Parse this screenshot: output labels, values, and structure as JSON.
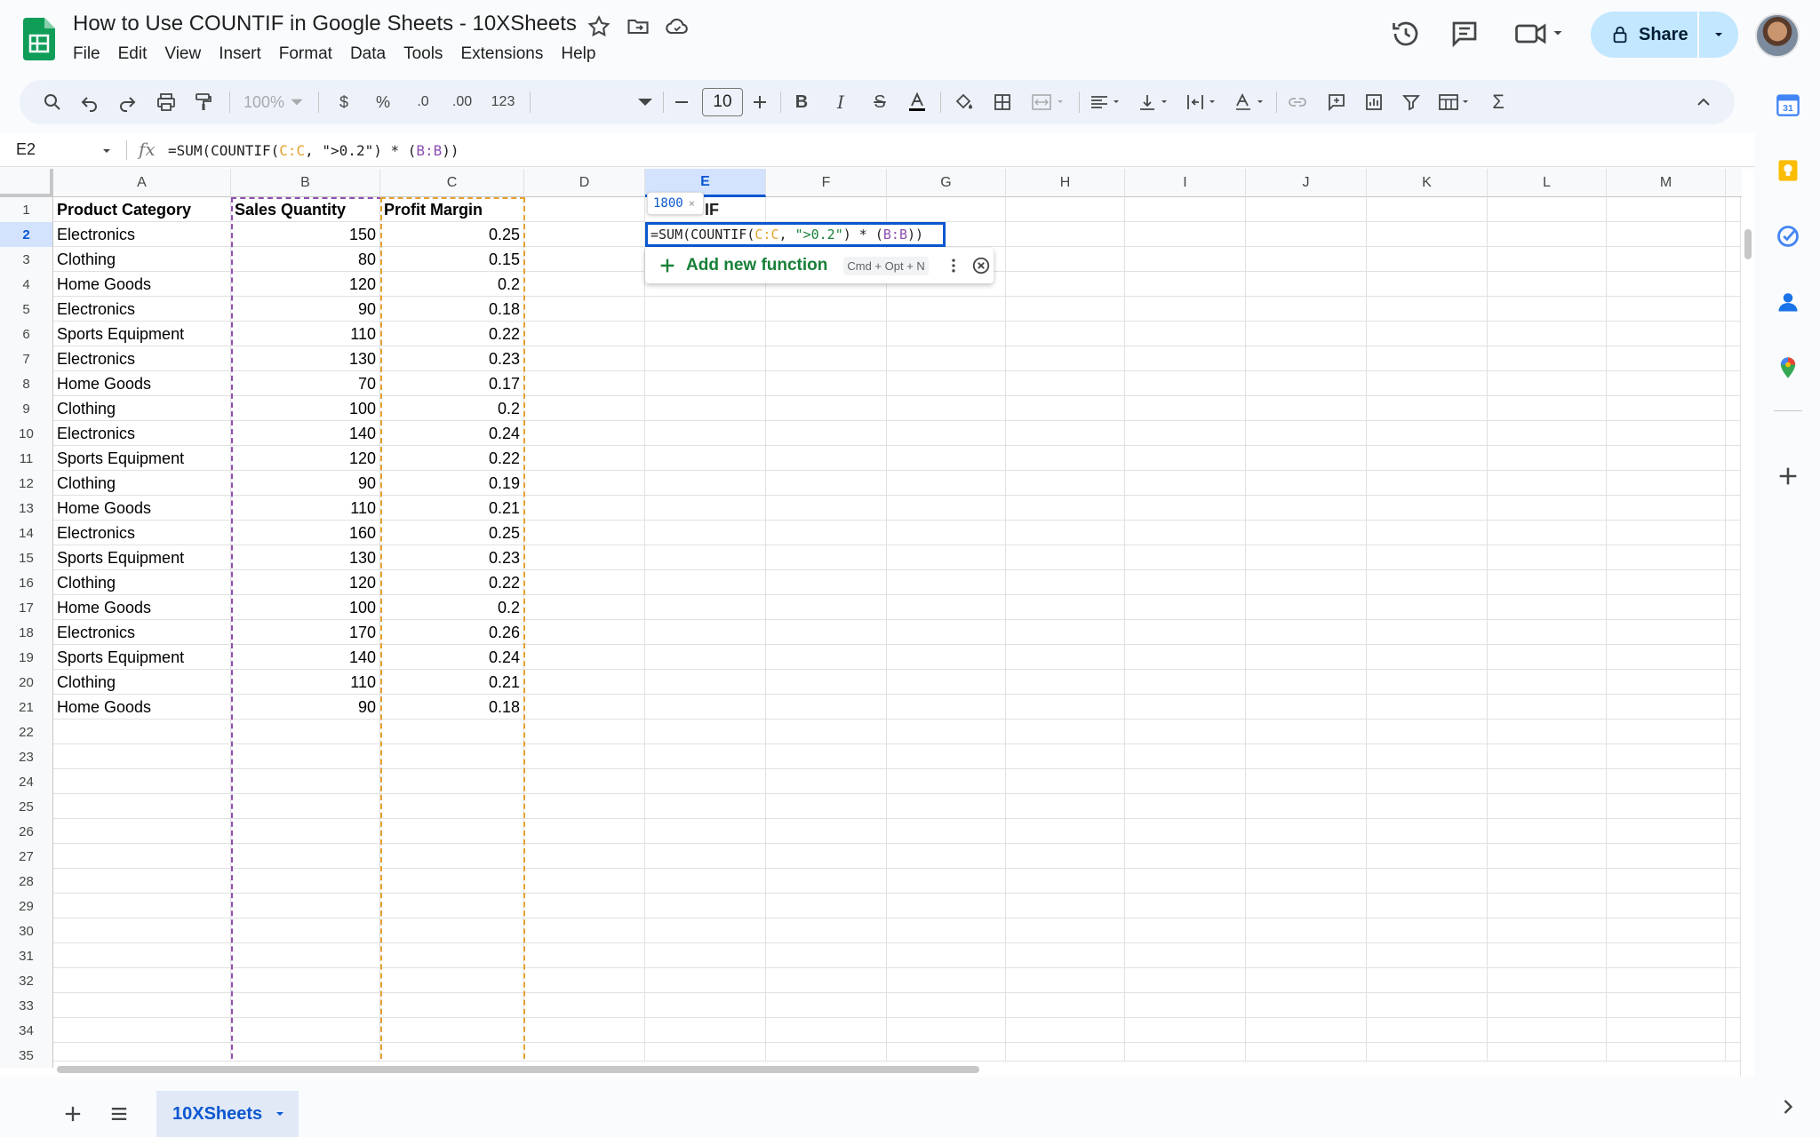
{
  "app": {
    "doc_title": "How to Use COUNTIF in Google Sheets - 10XSheets",
    "menu": [
      "File",
      "Edit",
      "View",
      "Insert",
      "Format",
      "Data",
      "Tools",
      "Extensions",
      "Help"
    ],
    "share_label": "Share"
  },
  "toolbar": {
    "zoom": "100%",
    "currency": "$",
    "percent": "%",
    "dec_decrease": ".0",
    "dec_increase": ".00",
    "number_format": "123",
    "font_size": "10"
  },
  "formula_bar": {
    "cell_ref": "E2",
    "fx": "fx",
    "formula_parts": [
      "=SUM(COUNTIF(",
      "C:C",
      ", ",
      "\">0.2\"",
      ") * (",
      "B:B",
      "))"
    ]
  },
  "grid": {
    "columns": [
      "A",
      "B",
      "C",
      "D",
      "E",
      "F",
      "G",
      "H",
      "I",
      "J",
      "K",
      "L",
      "M"
    ],
    "selected_column": "E",
    "headers": [
      "Product Category",
      "Sales Quantity",
      "Profit Margin"
    ],
    "rows": [
      [
        "Electronics",
        "150",
        "0.25"
      ],
      [
        "Clothing",
        "80",
        "0.15"
      ],
      [
        "Home Goods",
        "120",
        "0.2"
      ],
      [
        "Electronics",
        "90",
        "0.18"
      ],
      [
        "Sports Equipment",
        "110",
        "0.22"
      ],
      [
        "Electronics",
        "130",
        "0.23"
      ],
      [
        "Home Goods",
        "70",
        "0.17"
      ],
      [
        "Clothing",
        "100",
        "0.2"
      ],
      [
        "Electronics",
        "140",
        "0.24"
      ],
      [
        "Sports Equipment",
        "120",
        "0.22"
      ],
      [
        "Clothing",
        "90",
        "0.19"
      ],
      [
        "Home Goods",
        "110",
        "0.21"
      ],
      [
        "Electronics",
        "160",
        "0.25"
      ],
      [
        "Sports Equipment",
        "130",
        "0.23"
      ],
      [
        "Clothing",
        "120",
        "0.22"
      ],
      [
        "Home Goods",
        "100",
        "0.2"
      ],
      [
        "Electronics",
        "170",
        "0.26"
      ],
      [
        "Sports Equipment",
        "140",
        "0.24"
      ],
      [
        "Clothing",
        "110",
        "0.21"
      ],
      [
        "Home Goods",
        "90",
        "0.18"
      ]
    ],
    "row_numbers": [
      "1",
      "2",
      "3",
      "4",
      "5",
      "6",
      "7",
      "8",
      "9",
      "10",
      "11",
      "12",
      "13",
      "14",
      "15",
      "16",
      "17",
      "18",
      "19",
      "20",
      "21",
      "22",
      "23",
      "24",
      "25",
      "26",
      "27",
      "28",
      "29",
      "30",
      "31",
      "32",
      "33",
      "34",
      "35"
    ],
    "selected_row": "2",
    "e1_visible_text": "IF"
  },
  "editor": {
    "preview_value": "1800",
    "preview_close": "×",
    "add_function_label": "Add new function",
    "shortcut": "Cmd + Opt + N"
  },
  "sheets": {
    "active_tab": "10XSheets"
  },
  "colors": {
    "accent": "#0b57d0",
    "range_b": "#8e4fb1",
    "range_c": "#e5a12e",
    "share_bg": "#c2e7ff"
  },
  "icons": [
    "sheets-logo",
    "star-icon",
    "move-folder-icon",
    "cloud-status-icon",
    "history-icon",
    "comment-icon",
    "meet-icon",
    "lock-icon",
    "search-icon",
    "undo-icon",
    "redo-icon",
    "print-icon",
    "paint-format-icon",
    "bold-icon",
    "italic-icon",
    "strikethrough-icon",
    "text-color-icon",
    "fill-color-icon",
    "borders-icon",
    "merge-icon",
    "align-icon",
    "valign-icon",
    "wrap-icon",
    "rotate-icon",
    "link-icon",
    "add-comment-icon",
    "chart-icon",
    "filter-icon",
    "table-view-icon",
    "sum-icon",
    "collapse-icon",
    "calendar-icon",
    "keep-icon",
    "tasks-icon",
    "contacts-icon",
    "maps-icon",
    "add-icon",
    "sheet-list-icon"
  ]
}
